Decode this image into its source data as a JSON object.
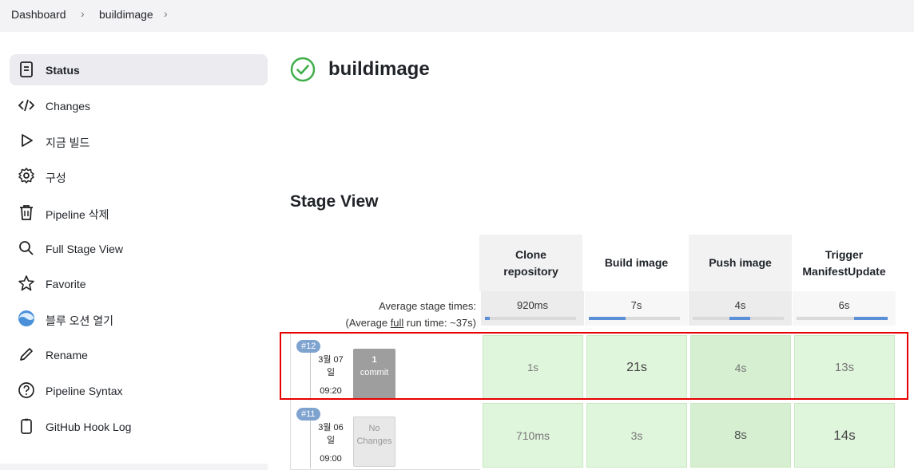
{
  "breadcrumb": [
    "Dashboard",
    "buildimage"
  ],
  "sidebar": {
    "items": [
      {
        "label": "Status",
        "icon": "status-document-icon",
        "active": true
      },
      {
        "label": "Changes",
        "icon": "code-icon"
      },
      {
        "label": "지금 빌드",
        "icon": "play-icon"
      },
      {
        "label": "구성",
        "icon": "gear-icon"
      },
      {
        "label": "Pipeline 삭제",
        "icon": "trash-icon"
      },
      {
        "label": "Full Stage View",
        "icon": "search-icon"
      },
      {
        "label": "Favorite",
        "icon": "star-icon"
      },
      {
        "label": "블루 오션 열기",
        "icon": "blue-ocean-icon"
      },
      {
        "label": "Rename",
        "icon": "pencil-icon"
      },
      {
        "label": "Pipeline Syntax",
        "icon": "help-circle-icon"
      },
      {
        "label": "GitHub Hook Log",
        "icon": "clipboard-icon"
      }
    ]
  },
  "page": {
    "title": "buildimage",
    "status_icon": "success-check-icon"
  },
  "stage_view": {
    "title": "Stage View",
    "stages": [
      {
        "name_line1": "Clone",
        "name_line2": "repository",
        "avg": "920ms",
        "avg_bar_fraction": 0.05,
        "avg_bar_start": 0.0
      },
      {
        "name_line1": "Build image",
        "name_line2": "",
        "avg": "7s",
        "avg_bar_fraction": 0.4,
        "avg_bar_start": 0.0
      },
      {
        "name_line1": "Push image",
        "name_line2": "",
        "avg": "4s",
        "avg_bar_fraction": 0.23,
        "avg_bar_start": 0.4
      },
      {
        "name_line1": "Trigger",
        "name_line2": "ManifestUpdate",
        "avg": "6s",
        "avg_bar_fraction": 0.37,
        "avg_bar_start": 0.63
      }
    ],
    "avg_stage_label": "Average stage times:",
    "avg_full_prefix": "(Average ",
    "avg_full_link": "full",
    "avg_full_suffix": " run time: ~37s)",
    "runs": [
      {
        "badge": "#12",
        "date_line1": "3월 07",
        "date_line2": "일",
        "time": "09:20",
        "commit_line1": "1",
        "commit_line2": "commit",
        "commit_style": "dark",
        "durations": [
          "1s",
          "21s",
          "4s",
          "13s"
        ],
        "highlighted": true
      },
      {
        "badge": "#11",
        "date_line1": "3월 06",
        "date_line2": "일",
        "time": "09:00",
        "commit_line1": "No",
        "commit_line2": "Changes",
        "commit_style": "light",
        "durations": [
          "710ms",
          "3s",
          "8s",
          "14s"
        ],
        "highlighted": false
      }
    ]
  },
  "colors": {
    "success_green": "#3fae49",
    "stage_cell": "#e0f6dc",
    "highlight_border": "#e60000",
    "badge_blue": "#7fa3cf"
  }
}
